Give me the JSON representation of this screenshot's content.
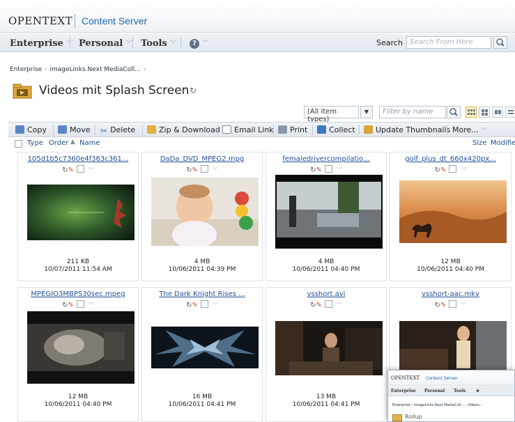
{
  "header": {
    "logo": "OPENTEXT",
    "product": "Content Server"
  },
  "menu": {
    "items": [
      "Enterprise",
      "Personal",
      "Tools"
    ],
    "help_icon": "?",
    "search_label": "Search",
    "search_placeholder": "Search From Here"
  },
  "breadcrumb": [
    "Enterprise",
    "imageLinks.Next MediaColl..."
  ],
  "title": "Videos mit Splash Screen",
  "filter": {
    "type_value": "(All item types)",
    "filter_placeholder": "Filter by name"
  },
  "toolbar": [
    "Copy",
    "Move",
    "Delete",
    "Zip & Download",
    "Email Link",
    "Print",
    "Collect",
    "Update Thumbnails",
    "More..."
  ],
  "columns": {
    "type": "Type",
    "order": "Order",
    "name": "Name",
    "size": "Size",
    "modified": "Modifie"
  },
  "items": [
    {
      "name": "105d1b5c7360e4f363c361...",
      "size": "211 KB",
      "date": "10/07/2011 11:54 AM"
    },
    {
      "name": "DaDa_DVD_MPEG2.mpg",
      "size": "4 MB",
      "date": "10/06/2011 04:39 PM"
    },
    {
      "name": "femaledrivercompilatio...",
      "size": "4 MB",
      "date": "10/06/2011 04:40 PM"
    },
    {
      "name": "golf_plus_dt_660x420px...",
      "size": "12 MB",
      "date": "10/06/2011 04:40 PM"
    },
    {
      "name": "MPEGIO3MBPS30sec.mpeg",
      "size": "12 MB",
      "date": "10/06/2011 04:40 PM"
    },
    {
      "name": "The Dark Knight Rises ...",
      "size": "16 MB",
      "date": "10/06/2011 04:41 PM"
    },
    {
      "name": "vsshort.avi",
      "size": "13 MB",
      "date": "10/06/2011 04:41 PM"
    },
    {
      "name": "vsshort-aac.mkv",
      "size": "",
      "date": ""
    }
  ],
  "mini_window": {
    "logo": "OPENTEXT",
    "product": "Content Server",
    "menu": [
      "Enterprise",
      "Personal",
      "Tools"
    ],
    "breadcrumb": "Enterprise › imageLinks.Next MediaColl... › Videos ›",
    "title": "Rollup"
  }
}
